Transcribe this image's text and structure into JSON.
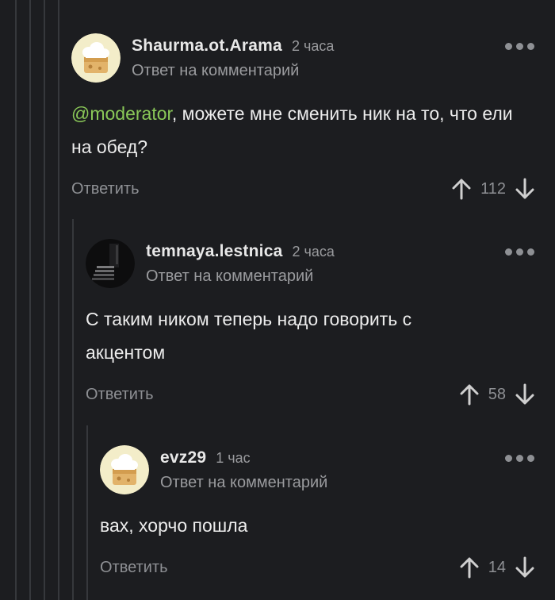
{
  "comments": [
    {
      "author": "Shaurma.ot.Arama",
      "time": "2 часа",
      "reply_to": "Ответ на комментарий",
      "mention": "@moderator",
      "text": ", можете мне сменить ник на то, что ели на обед?",
      "reply_label": "Ответить",
      "score": "112",
      "avatar_icon": "cheese-avatar-icon"
    },
    {
      "author": "temnaya.lestnica",
      "time": "2 часа",
      "reply_to": "Ответ на комментарий",
      "text": "С таким ником теперь надо говорить с акцентом",
      "reply_label": "Ответить",
      "score": "58",
      "avatar_icon": "dark-stairs-avatar-icon"
    },
    {
      "author": "evz29",
      "time": "1 час",
      "reply_to": "Ответ на комментарий",
      "text": "вах, хорчо пошла",
      "reply_label": "Ответить",
      "score": "14",
      "avatar_icon": "cheese-avatar-icon"
    }
  ],
  "colors": {
    "background": "#1c1d20",
    "mention": "#8ac858",
    "muted": "#8e9094",
    "text": "#ececec"
  }
}
